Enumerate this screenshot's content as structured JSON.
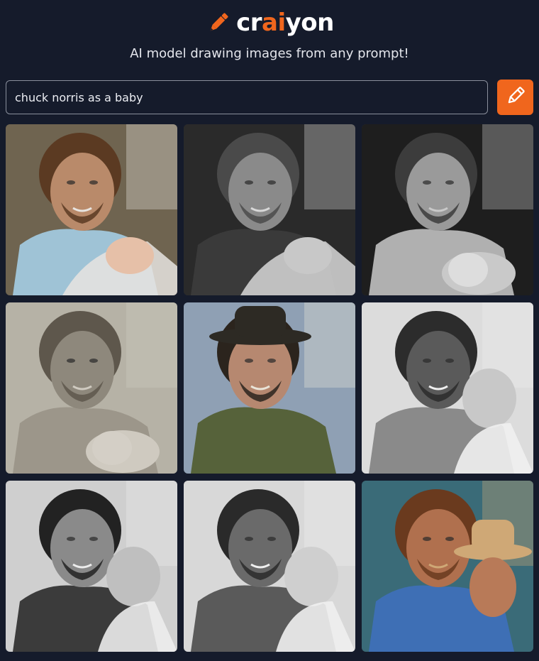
{
  "header": {
    "logo": {
      "icon": "pencil-icon",
      "text_prefix": "cr",
      "text_accent": "ai",
      "text_suffix": "yon",
      "accent_color": "#f0661d"
    },
    "tagline": "AI model drawing images from any prompt!"
  },
  "search": {
    "value": "chuck norris as a baby",
    "button_icon": "pencil-icon",
    "button_color": "#f0661d"
  },
  "results": {
    "images": [
      {
        "theme": "color",
        "bg": "#6f6450",
        "face": "#b98a6a",
        "hair": "#5b3a22",
        "shirt": "#9fc3d6",
        "accent": "#e8e4e0",
        "baby": "#e6c0a8",
        "extra": "blanket"
      },
      {
        "theme": "bw",
        "bg": "#2a2a2a",
        "face": "#8a8a8a",
        "hair": "#4a4a4a",
        "shirt": "#3a3a3a",
        "accent": "#d8d8d8",
        "baby": "#c8c8c8",
        "extra": "blanket"
      },
      {
        "theme": "bw",
        "bg": "#1e1e1e",
        "face": "#9a9a9a",
        "hair": "#3c3c3c",
        "shirt": "#b0b0b0",
        "accent": "#c9c9c9",
        "baby": "#dddddd",
        "extra": "baby-low"
      },
      {
        "theme": "bw",
        "bg": "#b6b2a6",
        "face": "#8e887c",
        "hair": "#5e574c",
        "shirt": "#9c968a",
        "accent": "#cfcac0",
        "baby": "#d4cfc6",
        "extra": "baby-low"
      },
      {
        "theme": "color",
        "bg": "#8fa0b4",
        "face": "#b68870",
        "hair": "#2b241d",
        "shirt": "#56623a",
        "accent": "#e9e4d8",
        "baby": "#e2b08e",
        "extra": "cowboy-hat"
      },
      {
        "theme": "bw",
        "bg": "#dcdcdc",
        "face": "#5a5a5a",
        "hair": "#2c2c2c",
        "shirt": "#8a8a8a",
        "accent": "#efefef",
        "baby": "#c8c8c8",
        "extra": "baby-right"
      },
      {
        "theme": "bw",
        "bg": "#cfcfcf",
        "face": "#8a8a8a",
        "hair": "#222222",
        "shirt": "#3b3b3b",
        "accent": "#ececec",
        "baby": "#bfbfbf",
        "extra": "baby-right"
      },
      {
        "theme": "bw",
        "bg": "#d8d8d8",
        "face": "#6a6a6a",
        "hair": "#2a2a2a",
        "shirt": "#5a5a5a",
        "accent": "#f0f0f0",
        "baby": "#cfcfcf",
        "extra": "baby-right"
      },
      {
        "theme": "color",
        "bg": "#3a6b78",
        "face": "#b0704e",
        "hair": "#6a3a1e",
        "shirt": "#3e6fb5",
        "accent": "#cfa876",
        "baby": "#b87a58",
        "extra": "cowboy-right"
      }
    ]
  }
}
